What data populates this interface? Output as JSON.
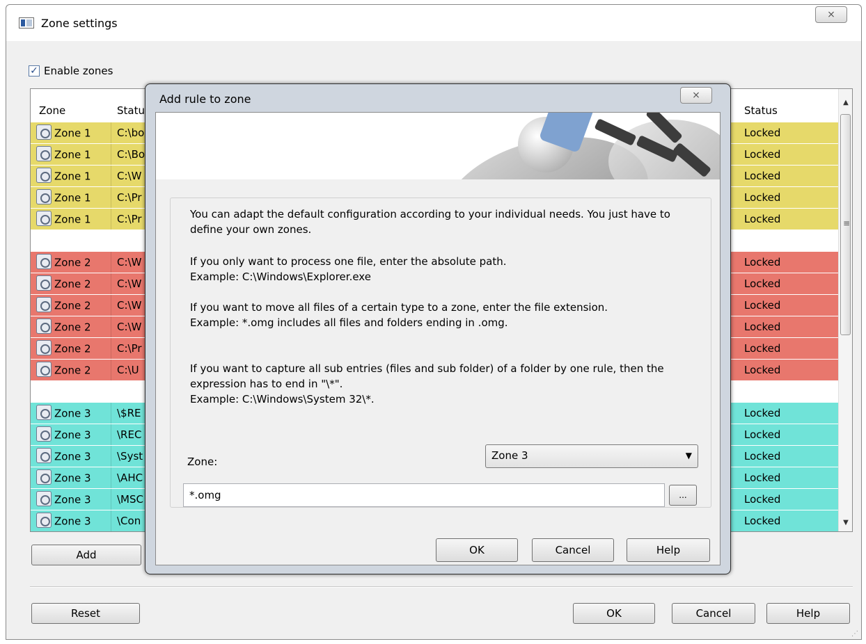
{
  "main_window": {
    "title": "Zone settings",
    "close_glyph": "⨯",
    "enable_label": "Enable zones",
    "enable_checked": true,
    "columns": {
      "zone": "Zone",
      "status_left": "Statu",
      "status_right": "Status"
    },
    "rows": [
      {
        "zone": "Zone 1",
        "path": "C:\\bo",
        "status": "Locked",
        "color": "y"
      },
      {
        "zone": "Zone 1",
        "path": "C:\\Bo",
        "status": "Locked",
        "color": "y"
      },
      {
        "zone": "Zone 1",
        "path": "C:\\W",
        "status": "Locked",
        "color": "y"
      },
      {
        "zone": "Zone 1",
        "path": "C:\\Pr",
        "status": "Locked",
        "color": "y"
      },
      {
        "zone": "Zone 1",
        "path": "C:\\Pr",
        "status": "Locked",
        "color": "y"
      },
      {
        "gap": true
      },
      {
        "zone": "Zone 2",
        "path": "C:\\W",
        "status": "Locked",
        "color": "r"
      },
      {
        "zone": "Zone 2",
        "path": "C:\\W",
        "status": "Locked",
        "color": "r"
      },
      {
        "zone": "Zone 2",
        "path": "C:\\W",
        "status": "Locked",
        "color": "r"
      },
      {
        "zone": "Zone 2",
        "path": "C:\\W",
        "status": "Locked",
        "color": "r"
      },
      {
        "zone": "Zone 2",
        "path": "C:\\Pr",
        "status": "Locked",
        "color": "r"
      },
      {
        "zone": "Zone 2",
        "path": "C:\\U",
        "status": "Locked",
        "color": "r"
      },
      {
        "gap": true
      },
      {
        "zone": "Zone 3",
        "path": "\\$RE",
        "status": "Locked",
        "color": "c"
      },
      {
        "zone": "Zone 3",
        "path": "\\REC",
        "status": "Locked",
        "color": "c"
      },
      {
        "zone": "Zone 3",
        "path": "\\Syst",
        "status": "Locked",
        "color": "c"
      },
      {
        "zone": "Zone 3",
        "path": "\\AHC",
        "status": "Locked",
        "color": "c"
      },
      {
        "zone": "Zone 3",
        "path": "\\MSC",
        "status": "Locked",
        "color": "c"
      },
      {
        "zone": "Zone 3",
        "path": "\\Con",
        "status": "Locked",
        "color": "c"
      }
    ],
    "buttons": {
      "add": "Add",
      "reset": "Reset",
      "ok": "OK",
      "cancel": "Cancel",
      "help": "Help"
    },
    "colors": {
      "zone1": "#e6d96a",
      "zone2": "#e8776d",
      "zone3": "#70e3d8"
    }
  },
  "dialog": {
    "title": "Add rule to zone",
    "close_glyph": "⨯",
    "paragraphs": [
      "You can adapt the default configuration according to your individual needs. You just have to define your own zones.",
      "If you only want to process one file, enter the absolute path.\nExample: C:\\Windows\\Explorer.exe",
      "If you want to move all files of a certain type to a zone, enter the file extension.\nExample: *.omg includes all files and folders ending in .omg.",
      "If you want to capture all sub entries (files and sub folder) of a folder by one rule, then the expression has to end in \"\\*\".\nExample: C:\\Windows\\System 32\\*."
    ],
    "zone_label": "Zone:",
    "zone_selected": "Zone 3",
    "path_value": "*.omg",
    "browse_label": "...",
    "buttons": {
      "ok": "OK",
      "cancel": "Cancel",
      "help": "Help"
    }
  },
  "icons": {
    "app": "app-window-icon",
    "zone": "zone-lock-icon",
    "dropdown": "chevron-down-icon",
    "scroll_up": "arrow-up-icon",
    "scroll_down": "arrow-down-icon"
  }
}
